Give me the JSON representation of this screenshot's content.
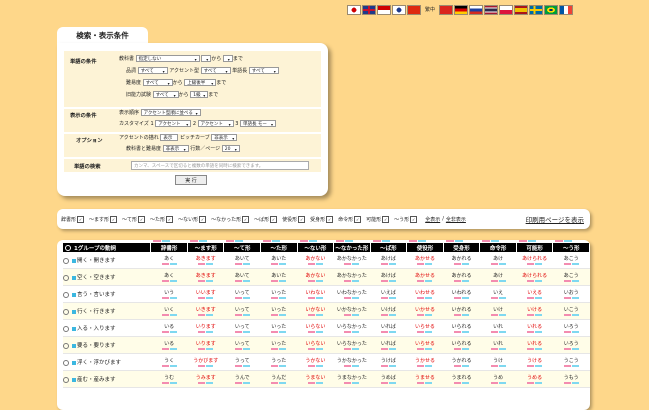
{
  "flags": [
    {
      "name": "japan",
      "c1": "#ffffff",
      "c2": "#d00000"
    },
    {
      "name": "uk",
      "c1": "#1f3a8a",
      "c2": "#c8102e"
    },
    {
      "name": "indonesia",
      "c1": "#d00000",
      "c2": "#ffffff"
    },
    {
      "name": "korea",
      "c1": "#ffffff",
      "c2": "#1f3a8a"
    },
    {
      "name": "china",
      "c1": "#de2910",
      "c2": "#de2910"
    },
    {
      "name": "taiwan",
      "c1": "#fe0000",
      "c2": "#000095"
    },
    {
      "name": "vietnam",
      "c1": "#da251d",
      "c2": "#da251d"
    },
    {
      "name": "germany",
      "c1": "#000000",
      "c2": "#ffcc00"
    },
    {
      "name": "russia",
      "c1": "#ffffff",
      "c2": "#1c3fa0"
    },
    {
      "name": "thailand",
      "c1": "#a51931",
      "c2": "#2d2a4a"
    },
    {
      "name": "poland",
      "c1": "#ffffff",
      "c2": "#dc143c"
    },
    {
      "name": "spain",
      "c1": "#aa151b",
      "c2": "#f1bf00"
    },
    {
      "name": "sweden",
      "c1": "#006aa7",
      "c2": "#fecc00"
    },
    {
      "name": "brazil",
      "c1": "#009c3b",
      "c2": "#ffdf00"
    },
    {
      "name": "france",
      "c1": "#0055a4",
      "c2": "#ef4135"
    }
  ],
  "taiwan_label": "繁中",
  "search": {
    "tab_label": "検索・表示条件",
    "words_condition_label": "単語の条件",
    "textbook_label": "教科書",
    "textbook_value": "指定しない",
    "lesson_from": "",
    "from_text": "から",
    "lesson_to": "",
    "to_text": "まで",
    "pos_label": "品詞",
    "pos_value": "すべて",
    "accent_type_label": "アクセント型",
    "accent_type_value": "すべて",
    "word_length_label": "単語長",
    "word_length_value": "すべて",
    "difficulty_label": "難易度",
    "difficulty_from": "すべて",
    "difficulty_kara": "から",
    "difficulty_to": "上級後半",
    "difficulty_made": "まで",
    "old_test_label": "旧能力試験",
    "old_test_from": "すべて",
    "old_test_kara": "から",
    "old_test_to": "1級",
    "old_test_made": "まで",
    "display_condition_label": "表示の条件",
    "display_order_label": "表示順序",
    "display_order_value": "アクセント型順に並べる",
    "customize_label": "カスタマイズ",
    "customize_1": "1",
    "customize_1_value": "アクセント",
    "customize_2": "2",
    "customize_2_value": "アクセント",
    "customize_3": "3",
    "customize_3_value": "単語長 モー",
    "options_label": "オプション",
    "accent_style_label": "アクセントの描れ",
    "accent_style_value": "表示",
    "pitch_curve_label": "ピッチカーブ",
    "pitch_curve_value": "非表示",
    "textbook_difficulty_label": "教科書と難易度",
    "textbook_difficulty_value": "非表示",
    "rows_per_page_label": "行数／ページ",
    "rows_per_page_value": "20",
    "word_search_label": "単語の検索",
    "word_search_placeholder": "カンマ、スペースで区切ると複数の単語を同時に検索できます。",
    "execute_label": "実 行"
  },
  "filters": {
    "items": [
      "辞書形",
      "～ます形",
      "～て形",
      "～た形",
      "～ない形",
      "～なかった形",
      "～ば形",
      "使役形",
      "受身形",
      "命令形",
      "可能形",
      "～う形"
    ],
    "show_all": "全表示",
    "separator": "/",
    "hide_all": "全非表示",
    "print_link": "印刷用ページを表示"
  },
  "table": {
    "group_header": "1グループの動詞",
    "columns": [
      "辞書形",
      "～ます形",
      "～て形",
      "～た形",
      "～ない形",
      "～なかった形",
      "～ば形",
      "使役形",
      "受身形",
      "命令形",
      "可能形",
      "～う形"
    ],
    "rows": [
      {
        "label": "開く・開きます",
        "cells": [
          "あく",
          "あきます",
          "あいて",
          "あいた",
          "あかない",
          "あかなかった",
          "あけば",
          "あかせる",
          "あかれる",
          "あけ",
          "あけられる",
          "あこう"
        ]
      },
      {
        "label": "空く・空きます",
        "cells": [
          "あく",
          "あきます",
          "あいて",
          "あいた",
          "あかない",
          "あかなかった",
          "あけば",
          "あかせる",
          "あかれる",
          "あけ",
          "あけられる",
          "あこう"
        ]
      },
      {
        "label": "言う・言います",
        "cells": [
          "いう",
          "いいます",
          "いって",
          "いった",
          "いわない",
          "いわなかった",
          "いえば",
          "いわせる",
          "いわれる",
          "いえ",
          "いえる",
          "いおう"
        ]
      },
      {
        "label": "行く・行きます",
        "cells": [
          "いく",
          "いきます",
          "いって",
          "いった",
          "いかない",
          "いかなかった",
          "いけば",
          "いかせる",
          "いかれる",
          "いけ",
          "いける",
          "いこう"
        ]
      },
      {
        "label": "入る・入ります",
        "cells": [
          "いる",
          "いります",
          "いって",
          "いった",
          "いらない",
          "いらなかった",
          "いれば",
          "いらせる",
          "いられる",
          "いれ",
          "いれる",
          "いろう"
        ]
      },
      {
        "label": "要る・要ります",
        "cells": [
          "いる",
          "いります",
          "いって",
          "いった",
          "いらない",
          "いらなかった",
          "いれば",
          "いらせる",
          "いられる",
          "いれ",
          "いれる",
          "いろう"
        ]
      },
      {
        "label": "浮く・浮かびます",
        "cells": [
          "うく",
          "うかびます",
          "うって",
          "うった",
          "うかない",
          "うかなかった",
          "うけば",
          "うかせる",
          "うかれる",
          "うけ",
          "うける",
          "うこう"
        ]
      },
      {
        "label": "産む・産みます",
        "cells": [
          "うむ",
          "うみます",
          "うんで",
          "うんだ",
          "うまない",
          "うまなかった",
          "うめば",
          "うませる",
          "うまれる",
          "うめ",
          "うめる",
          "うもう"
        ]
      }
    ]
  }
}
